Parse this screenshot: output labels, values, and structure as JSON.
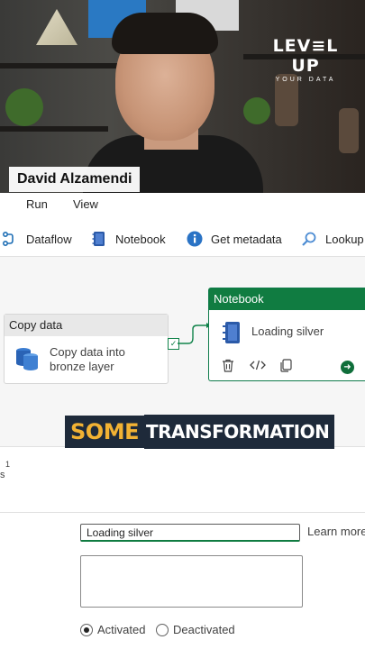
{
  "webcam": {
    "presenter_name": "David Alzamendi",
    "brand_line1": "LEV≡L UP",
    "brand_line2": "YOUR DATA"
  },
  "menu": [
    "Run",
    "View"
  ],
  "toolbar": {
    "items": [
      {
        "label": "Dataflow",
        "icon": "dataflow-icon"
      },
      {
        "label": "Notebook",
        "icon": "notebook-icon"
      },
      {
        "label": "Get metadata",
        "icon": "info-icon"
      },
      {
        "label": "Lookup",
        "icon": "search-icon"
      }
    ]
  },
  "canvas": {
    "copy_card": {
      "header": "Copy data",
      "line1": "Copy data into",
      "line2": "bronze layer"
    },
    "notebook_card": {
      "header": "Notebook",
      "title": "Loading silver"
    }
  },
  "banner": {
    "word1": "SOME",
    "word2": "TRANSFORMATION"
  },
  "properties": {
    "tab_number": "1",
    "tab_cut": "s",
    "name_value": "Loading silver",
    "learn_more": "Learn more",
    "activated": "Activated",
    "deactivated": "Deactivated"
  },
  "colors": {
    "accent": "#107c41",
    "banner_bg": "#1e2a3a",
    "banner_highlight": "#f2b233"
  }
}
